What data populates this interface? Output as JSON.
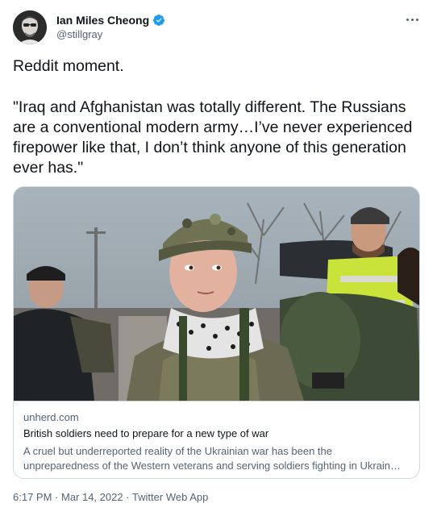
{
  "author": {
    "name": "Ian Miles Cheong",
    "handle": "@stillgray",
    "verified": true,
    "avatar_icon": "avatar-portrait"
  },
  "more_icon": "more-horizontal-icon",
  "tweet": {
    "paragraphs": [
      "Reddit moment.",
      "\"Iraq and Afghanistan was totally different. The Russians are a conventional modern army…I’ve never experienced firepower like that, I don’t think anyone of this generation ever has.\""
    ]
  },
  "card": {
    "domain": "unherd.com",
    "title": "British soldiers need to prepare for a new type of war",
    "description_line1": "A cruel but underreported reality of the Ukrainian war has been the",
    "description_line2": "unpreparedness of the Western veterans and serving soldiers fighting in Ukrain…",
    "image_alt": "photo-soldiers"
  },
  "meta": {
    "time": "6:17 PM",
    "separator1": " · ",
    "date": "Mar 14, 2022",
    "separator2": " · ",
    "source": "Twitter Web App"
  },
  "colors": {
    "verified": "#1d9bf0",
    "text": "#0f1419",
    "secondary": "#536471",
    "border": "#cfd9de"
  }
}
